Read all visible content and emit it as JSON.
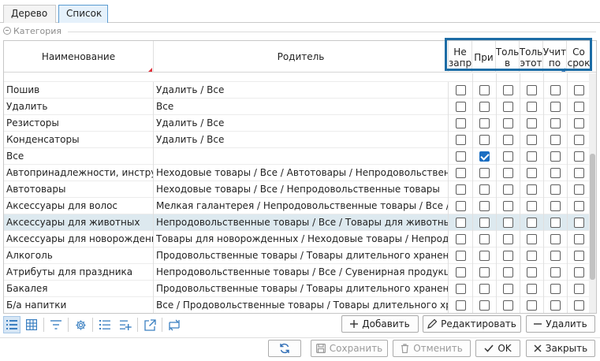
{
  "tabs": [
    {
      "label": "Дерево",
      "active": false
    },
    {
      "label": "Список",
      "active": true
    }
  ],
  "category": {
    "label": "Категория"
  },
  "grid": {
    "columns": {
      "name": "Наименование",
      "parent": "Родитель",
      "flags": [
        "Не\nзапр",
        "При",
        "Толь\nв",
        "Толь\nэтот",
        "Учит\nпо",
        "Со\nсрок"
      ]
    },
    "rows": [
      {
        "name": "Пошив",
        "parent": "Удалить / Все",
        "flags": [
          false,
          false,
          false,
          false,
          false,
          false
        ],
        "selected": false
      },
      {
        "name": "Удалить",
        "parent": "Все",
        "flags": [
          false,
          false,
          false,
          false,
          false,
          false
        ],
        "selected": false
      },
      {
        "name": "Резисторы",
        "parent": "Удалить / Все",
        "flags": [
          false,
          false,
          false,
          false,
          false,
          false
        ],
        "selected": false
      },
      {
        "name": "Конденсаторы",
        "parent": "Удалить / Все",
        "flags": [
          false,
          false,
          false,
          false,
          false,
          false
        ],
        "selected": false
      },
      {
        "name": "Все",
        "parent": "",
        "flags": [
          false,
          true,
          false,
          false,
          false,
          false
        ],
        "selected": false
      },
      {
        "name": "Автопринадлежности, инструмент",
        "parent": "Неходовые товары / Все / Автотовары / Непродовольственные товары",
        "flags": [
          false,
          false,
          false,
          false,
          false,
          false
        ],
        "selected": false
      },
      {
        "name": "Автотовары",
        "parent": "Неходовые товары / Все / Непродовольственные товары",
        "flags": [
          false,
          false,
          false,
          false,
          false,
          false
        ],
        "selected": false
      },
      {
        "name": "Аксессуары для волос",
        "parent": "Мелкая галантерея / Непродовольственные товары / Все / Неходовые товары",
        "flags": [
          false,
          false,
          false,
          false,
          false,
          false
        ],
        "selected": false
      },
      {
        "name": "Аксессуары для животных",
        "parent": "Непродовольственные товары / Все / Товары для животных / Ходовые товары",
        "flags": [
          false,
          false,
          false,
          false,
          false,
          false
        ],
        "selected": true
      },
      {
        "name": "Аксессуары для новорожденных",
        "parent": "Товары для новорожденных / Неходовые товары / Непродовольственные товары",
        "flags": [
          false,
          false,
          false,
          false,
          false,
          false
        ],
        "selected": false
      },
      {
        "name": "Алкоголь",
        "parent": "Продовольственные товары / Товары длительного хранения / Все",
        "flags": [
          false,
          false,
          false,
          false,
          false,
          false
        ],
        "selected": false
      },
      {
        "name": "Атрибуты для праздника",
        "parent": "Непродовольственные товары / Все / Сувенирная продукция / Неходовые товары",
        "flags": [
          false,
          false,
          false,
          false,
          false,
          false
        ],
        "selected": false
      },
      {
        "name": "Бакалея",
        "parent": "Продовольственные товары / Товары длительного хранения / Все",
        "flags": [
          false,
          false,
          false,
          false,
          false,
          false
        ],
        "selected": false
      },
      {
        "name": "Б/а напитки",
        "parent": "Все / Продовольственные товары / Товары длительного хранения / Все",
        "flags": [
          false,
          false,
          false,
          false,
          false,
          false
        ],
        "selected": false
      }
    ]
  },
  "toolbar": {
    "icons": [
      "list-view-icon",
      "table-view-icon",
      "filter-icon",
      "settings-icon",
      "numbered-list-icon",
      "add-list-icon",
      "export-icon",
      "transfer-icon"
    ],
    "add_label": "Добавить",
    "edit_label": "Редактировать",
    "delete_label": "Удалить"
  },
  "footer": {
    "refresh_icon": "refresh-icon",
    "save_label": "Сохранить",
    "cancel_label": "Отменить",
    "ok_label": "OK",
    "close_label": "Закрыть"
  },
  "colors": {
    "accent": "#1b6ec2",
    "highlight_frame": "#1c6ca5",
    "selected_row": "#dde9ef",
    "sort_mark": "#e0303a"
  }
}
